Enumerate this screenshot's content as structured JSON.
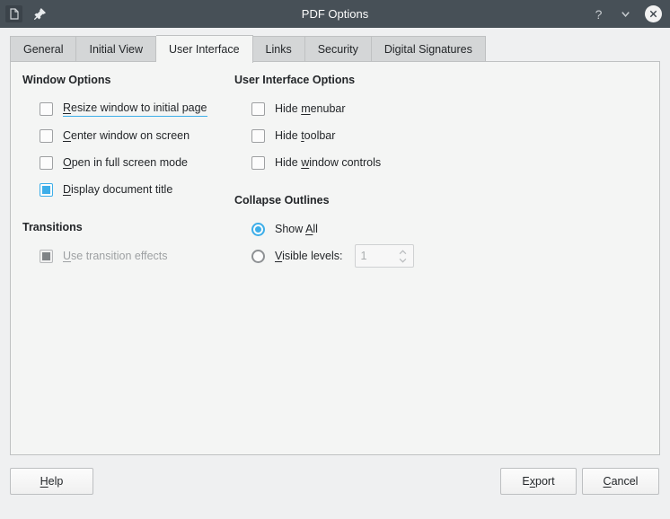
{
  "window": {
    "title": "PDF Options",
    "app_icon": "document-icon",
    "pin_icon": "pin-icon",
    "help_icon": "?",
    "menu_icon": "chevron-down-icon",
    "close_icon": "close-icon",
    "titlebar_color": "#475057",
    "accent_color": "#3daee9"
  },
  "tabs": [
    {
      "label": "General",
      "active": false
    },
    {
      "label": "Initial View",
      "active": false
    },
    {
      "label": "User Interface",
      "active": true
    },
    {
      "label": "Links",
      "active": false
    },
    {
      "label": "Security",
      "active": false
    },
    {
      "label": "Digital Signatures",
      "active": false
    }
  ],
  "window_options": {
    "title": "Window Options",
    "items": [
      {
        "label_pre": "",
        "mnemonic": "R",
        "label_post": "esize window to initial page",
        "checked": false,
        "focused": true,
        "disabled": false
      },
      {
        "label_pre": "",
        "mnemonic": "C",
        "label_post": "enter window on screen",
        "checked": false,
        "focused": false,
        "disabled": false
      },
      {
        "label_pre": "",
        "mnemonic": "O",
        "label_post": "pen in full screen mode",
        "checked": false,
        "focused": false,
        "disabled": false
      },
      {
        "label_pre": "",
        "mnemonic": "D",
        "label_post": "isplay document title",
        "checked": true,
        "focused": false,
        "disabled": false
      }
    ]
  },
  "ui_options": {
    "title": "User Interface Options",
    "items": [
      {
        "label_pre": "Hide ",
        "mnemonic": "m",
        "label_post": "enubar",
        "checked": false,
        "disabled": false
      },
      {
        "label_pre": "Hide ",
        "mnemonic": "t",
        "label_post": "oolbar",
        "checked": false,
        "disabled": false
      },
      {
        "label_pre": "Hide ",
        "mnemonic": "w",
        "label_post": "indow controls",
        "checked": false,
        "disabled": false
      }
    ]
  },
  "transitions": {
    "title": "Transitions",
    "items": [
      {
        "label_pre": "",
        "mnemonic": "U",
        "label_post": "se transition effects",
        "checked": true,
        "disabled": true
      }
    ]
  },
  "collapse_outlines": {
    "title": "Collapse Outlines",
    "options": [
      {
        "label_pre": "Show ",
        "mnemonic": "A",
        "label_post": "ll",
        "selected": true
      },
      {
        "label_pre": "",
        "mnemonic": "V",
        "label_post": "isible levels:",
        "selected": false
      }
    ],
    "spinbox": {
      "value": "1",
      "disabled": true,
      "up_icon": "chevron-up-icon",
      "down_icon": "chevron-down-icon"
    }
  },
  "buttons": {
    "help": {
      "pre": "",
      "mnemonic": "H",
      "post": "elp"
    },
    "export": {
      "pre": "E",
      "mnemonic": "x",
      "post": "port"
    },
    "cancel": {
      "pre": "",
      "mnemonic": "C",
      "post": "ancel"
    }
  }
}
